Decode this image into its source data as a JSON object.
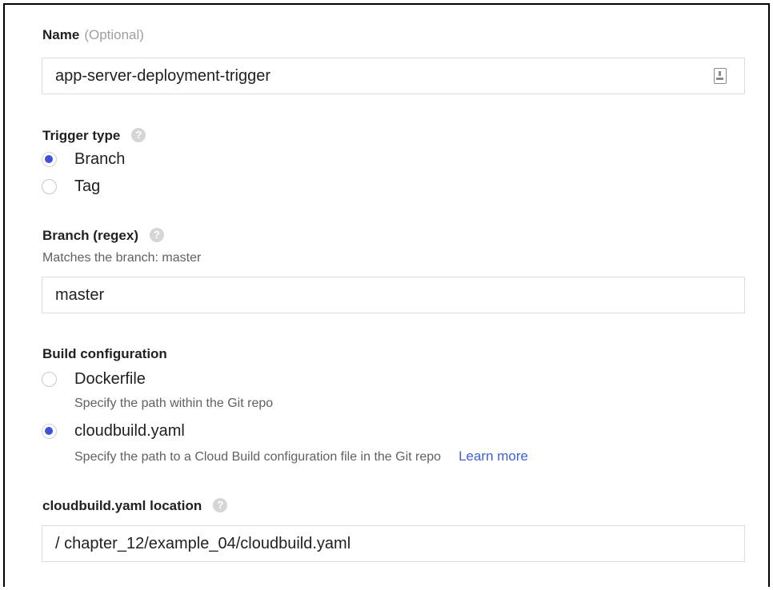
{
  "name_field": {
    "label": "Name",
    "optional_note": "(Optional)",
    "value": "app-server-deployment-trigger",
    "icon": "autofill-icon"
  },
  "trigger_type": {
    "label": "Trigger type",
    "options": [
      {
        "label": "Branch",
        "selected": true
      },
      {
        "label": "Tag",
        "selected": false
      }
    ]
  },
  "branch": {
    "label": "Branch (regex)",
    "hint": "Matches the branch: master",
    "value": "master"
  },
  "build_config": {
    "label": "Build configuration",
    "options": [
      {
        "label": "Dockerfile",
        "hint": "Specify the path within the Git repo",
        "selected": false
      },
      {
        "label": "cloudbuild.yaml",
        "hint": "Specify the path to a Cloud Build configuration file in the Git repo",
        "selected": true,
        "link": "Learn more"
      }
    ]
  },
  "location": {
    "label": "cloudbuild.yaml location",
    "prefix": "/",
    "value": "chapter_12/example_04/cloudbuild.yaml"
  },
  "colors": {
    "accent": "#3f51d8",
    "link": "#3b5fd9",
    "hint": "#616161"
  }
}
